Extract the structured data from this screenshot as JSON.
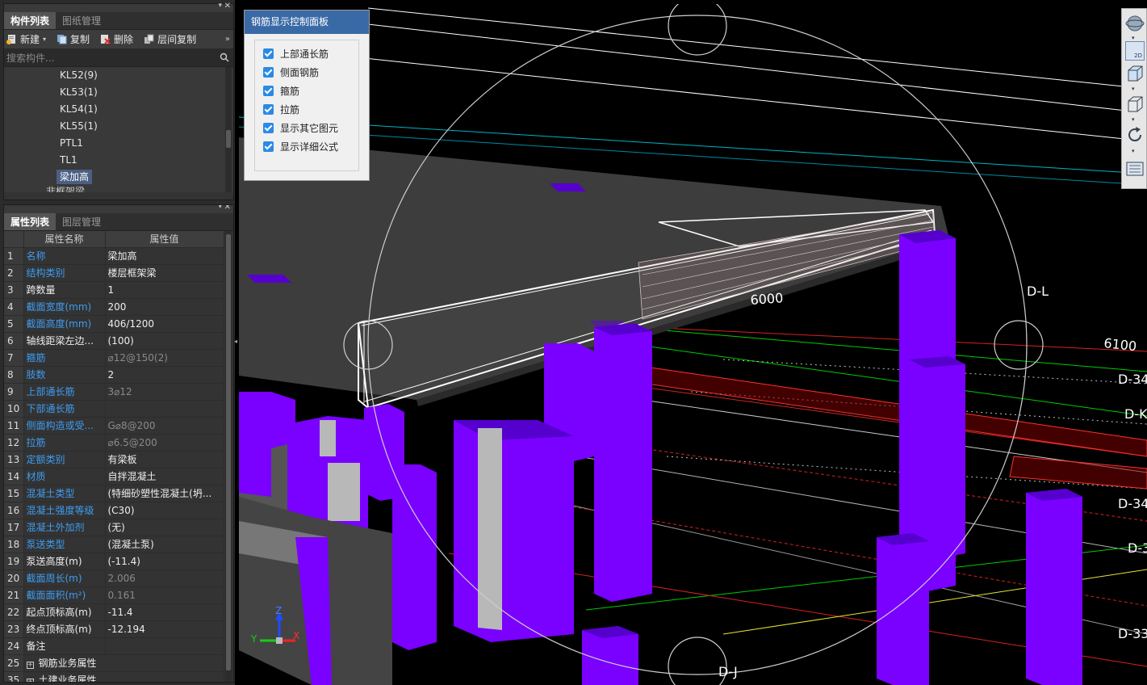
{
  "component_panel": {
    "tabs": [
      "构件列表",
      "图纸管理"
    ],
    "toolbar": {
      "new": "新建",
      "copy": "复制",
      "delete": "删除",
      "floor_copy": "层间复制"
    },
    "search_placeholder": "搜索构件...",
    "tree_items": [
      "KL52(9)",
      "KL53(1)",
      "KL54(1)",
      "KL55(1)",
      "PTL1",
      "TL1",
      "梁加高"
    ],
    "tree_group_cut": "非框架梁",
    "selected_item": "梁加高"
  },
  "property_panel": {
    "tabs": [
      "属性列表",
      "图层管理"
    ],
    "columns": [
      "属性名称",
      "属性值"
    ],
    "rows": [
      {
        "idx": "1",
        "name": "名称",
        "value": "梁加高",
        "name_style": "blue",
        "value_style": ""
      },
      {
        "idx": "2",
        "name": "结构类别",
        "value": "楼层框架梁",
        "name_style": "blue",
        "value_style": ""
      },
      {
        "idx": "3",
        "name": "跨数量",
        "value": "1",
        "name_style": "",
        "value_style": ""
      },
      {
        "idx": "4",
        "name": "截面宽度(mm)",
        "value": "200",
        "name_style": "blue",
        "value_style": ""
      },
      {
        "idx": "5",
        "name": "截面高度(mm)",
        "value": "406/1200",
        "name_style": "blue",
        "value_style": ""
      },
      {
        "idx": "6",
        "name": "轴线距梁左边...",
        "value": "(100)",
        "name_style": "",
        "value_style": ""
      },
      {
        "idx": "7",
        "name": "箍筋",
        "value": "⌀12@150(2)",
        "name_style": "blue",
        "value_style": "gray"
      },
      {
        "idx": "8",
        "name": "肢数",
        "value": "2",
        "name_style": "blue",
        "value_style": ""
      },
      {
        "idx": "9",
        "name": "上部通长筋",
        "value": "3⌀12",
        "name_style": "blue",
        "value_style": "gray"
      },
      {
        "idx": "10",
        "name": "下部通长筋",
        "value": "",
        "name_style": "blue",
        "value_style": ""
      },
      {
        "idx": "11",
        "name": "侧面构造或受...",
        "value": "G⌀8@200",
        "name_style": "blue",
        "value_style": "gray"
      },
      {
        "idx": "12",
        "name": "拉筋",
        "value": "⌀6.5@200",
        "name_style": "blue",
        "value_style": "gray"
      },
      {
        "idx": "13",
        "name": "定额类别",
        "value": "有梁板",
        "name_style": "blue",
        "value_style": ""
      },
      {
        "idx": "14",
        "name": "材质",
        "value": "自拌混凝土",
        "name_style": "blue",
        "value_style": ""
      },
      {
        "idx": "15",
        "name": "混凝土类型",
        "value": "(特细砂塑性混凝土(坍...",
        "name_style": "blue",
        "value_style": ""
      },
      {
        "idx": "16",
        "name": "混凝土强度等级",
        "value": "(C30)",
        "name_style": "blue",
        "value_style": ""
      },
      {
        "idx": "17",
        "name": "混凝土外加剂",
        "value": "(无)",
        "name_style": "blue",
        "value_style": ""
      },
      {
        "idx": "18",
        "name": "泵送类型",
        "value": "(混凝土泵)",
        "name_style": "blue",
        "value_style": ""
      },
      {
        "idx": "19",
        "name": "泵送高度(m)",
        "value": "(-11.4)",
        "name_style": "",
        "value_style": ""
      },
      {
        "idx": "20",
        "name": "截面周长(m)",
        "value": "2.006",
        "name_style": "blue",
        "value_style": "gray"
      },
      {
        "idx": "21",
        "name": "截面面积(m²)",
        "value": "0.161",
        "name_style": "blue",
        "value_style": "gray"
      },
      {
        "idx": "22",
        "name": "起点顶标高(m)",
        "value": "-11.4",
        "name_style": "",
        "value_style": ""
      },
      {
        "idx": "23",
        "name": "终点顶标高(m)",
        "value": "-12.194",
        "name_style": "",
        "value_style": ""
      },
      {
        "idx": "24",
        "name": "备注",
        "value": "",
        "name_style": "",
        "value_style": ""
      },
      {
        "idx": "25",
        "name": "钢筋业务属性",
        "value": "",
        "name_style": "",
        "value_style": "",
        "expand": true
      },
      {
        "idx": "35",
        "name": "土建业务属性",
        "value": "",
        "name_style": "",
        "value_style": "",
        "expand": true
      }
    ]
  },
  "rebar_panel": {
    "title": "钢筋显示控制面板",
    "options": [
      {
        "label": "上部通长筋",
        "checked": true
      },
      {
        "label": "侧面钢筋",
        "checked": true
      },
      {
        "label": "箍筋",
        "checked": true
      },
      {
        "label": "拉筋",
        "checked": true
      },
      {
        "label": "显示其它图元",
        "checked": true
      },
      {
        "label": "显示详细公式",
        "checked": true
      }
    ]
  },
  "viewport": {
    "axis_labels": [
      "D-L",
      "D-34",
      "D-K",
      "D-34",
      "D-3",
      "D-33",
      "D-J"
    ],
    "dimensions": [
      "6000",
      "6100"
    ],
    "gizmo": {
      "x": "X",
      "y": "Y",
      "z": "Z"
    },
    "view_2d_label": "2D",
    "colors": {
      "column": "#7a00ff",
      "column_top": "#5500cc",
      "slab": "#3d3d3d",
      "orbit": "#cfcfcf"
    }
  }
}
